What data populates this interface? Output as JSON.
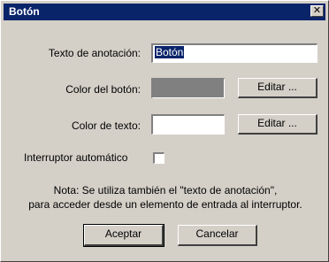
{
  "window": {
    "title": "Botón",
    "close_glyph": "✕"
  },
  "form": {
    "annotation_label": "Texto de anotación:",
    "annotation_value": "Botón",
    "button_color_label": "Color del botón:",
    "button_color_value": "#808080",
    "text_color_label": "Color de texto:",
    "text_color_value": "#ffffff",
    "edit_label": "Editar ...",
    "auto_switch_label": "Interruptor automático",
    "auto_switch_checked": false
  },
  "note": {
    "line1": "Nota: Se utiliza también el \"texto de anotación\",",
    "line2": "para acceder desde un elemento de entrada al interruptor."
  },
  "actions": {
    "accept_label": "Aceptar",
    "cancel_label": "Cancelar"
  }
}
